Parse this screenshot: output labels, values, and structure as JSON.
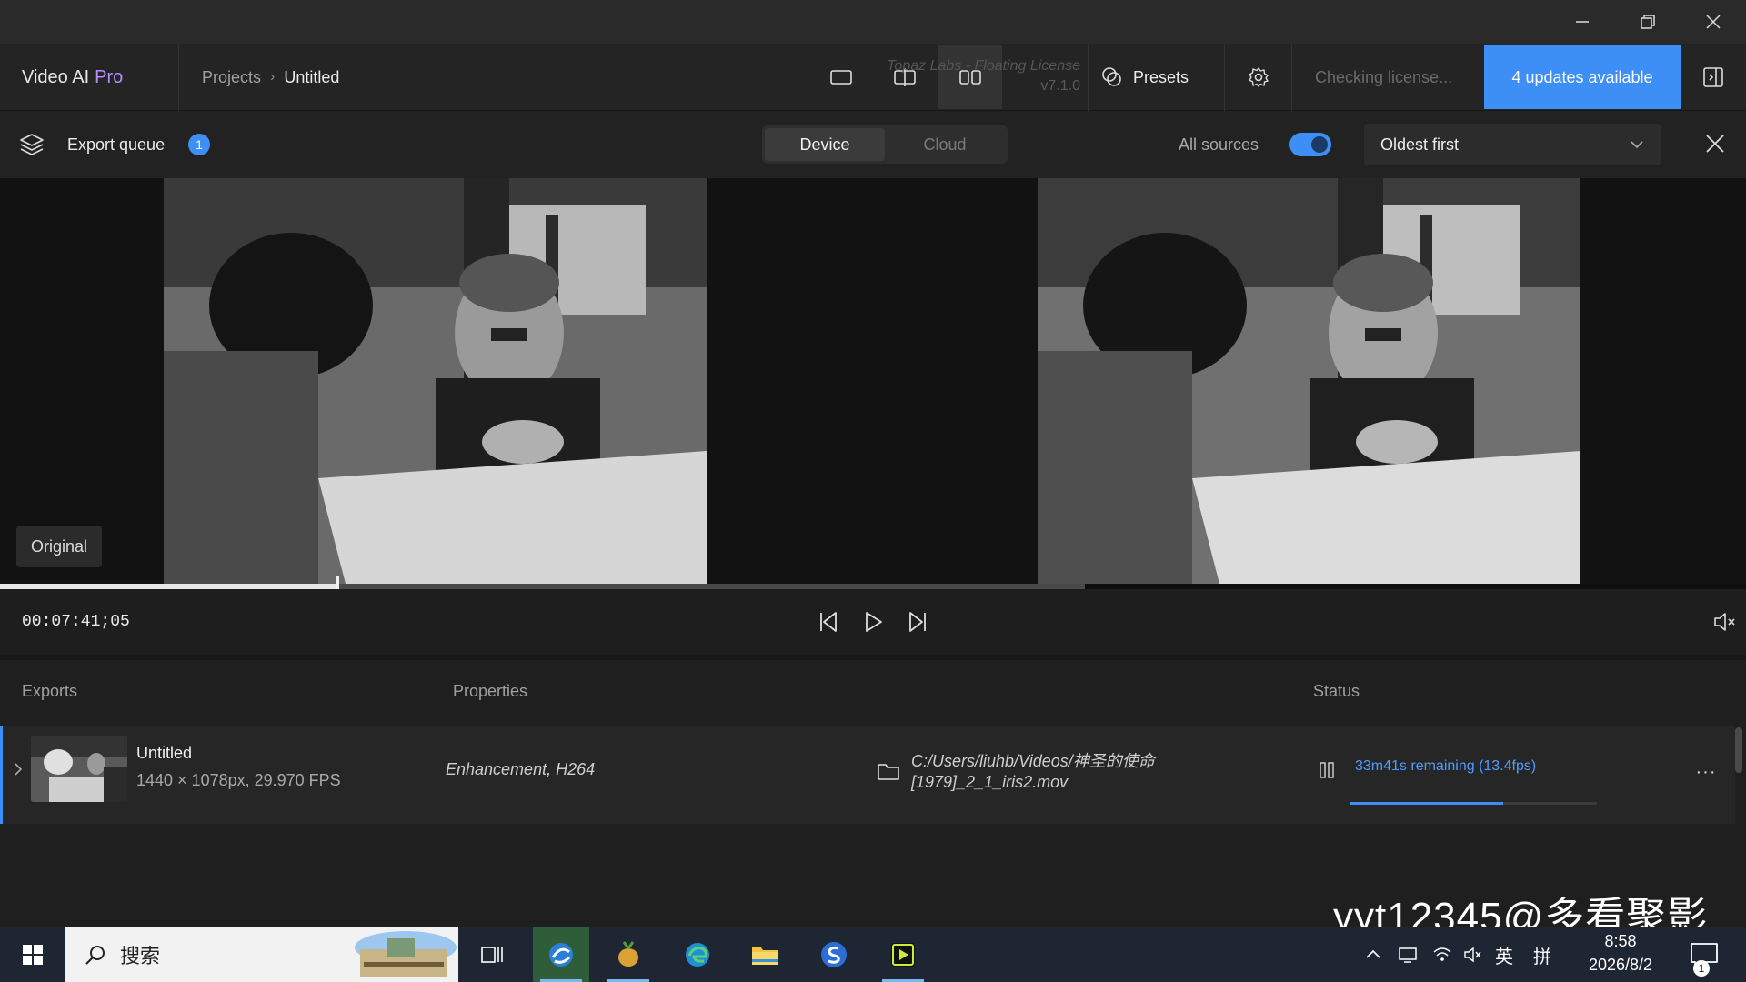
{
  "app": {
    "brand": "Video AI",
    "brand_suffix": "Pro",
    "breadcrumb": {
      "root": "Projects",
      "current": "Untitled"
    },
    "license": {
      "line1": "Topaz Labs - Floating License",
      "version": "v7.1.0"
    },
    "presets_label": "Presets",
    "checking_label": "Checking license...",
    "updates_label": "4 updates available"
  },
  "queue": {
    "title": "Export queue",
    "count": "1",
    "tabs": [
      "Device",
      "Cloud"
    ],
    "active_tab": "Device",
    "all_sources_label": "All sources",
    "all_sources_on": true,
    "sort_value": "Oldest first"
  },
  "preview": {
    "original_label": "Original",
    "timecode": "00:07:41;05",
    "playhead_fraction": 0.31
  },
  "exports_table": {
    "headers": {
      "exports": "Exports",
      "properties": "Properties",
      "status": "Status"
    },
    "rows": [
      {
        "title": "Untitled",
        "subtitle": "1440 × 1078px, 29.970 FPS",
        "properties": "Enhancement, H264",
        "path_line1": "C:/Users/liuhb/Videos/神圣的使命",
        "path_line2": "[1979]_2_1_iris2.mov",
        "status": "33m41s remaining (13.4fps)",
        "progress_fraction": 0.62
      }
    ]
  },
  "taskbar": {
    "search_placeholder": "搜索",
    "ime_lang": "英",
    "ime_mode": "拼",
    "time": "8:58",
    "date": "2026/8/2",
    "notifications": "1"
  },
  "overlay": {
    "watermark_caption": "yyt12345@多看聚影"
  },
  "colors": {
    "accent": "#3d8ff5",
    "pro": "#b98cff"
  }
}
